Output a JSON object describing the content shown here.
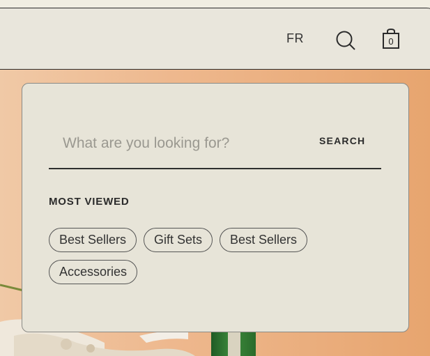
{
  "header": {
    "language": "FR",
    "cart_count": "0",
    "icons": {
      "search": "search-icon",
      "cart": "shopping-bag-icon"
    }
  },
  "search": {
    "placeholder": "What are you looking for?",
    "button_label": "SEARCH"
  },
  "most_viewed": {
    "title": "MOST VIEWED",
    "chips": [
      "Best Sellers",
      "Gift Sets",
      "Best Sellers",
      "Accessories"
    ]
  },
  "colors": {
    "panel_bg": "#e7e4d8",
    "header_bg": "#e9e6dc",
    "hero_bg": "#e8a978",
    "text": "#2b2b2b"
  }
}
